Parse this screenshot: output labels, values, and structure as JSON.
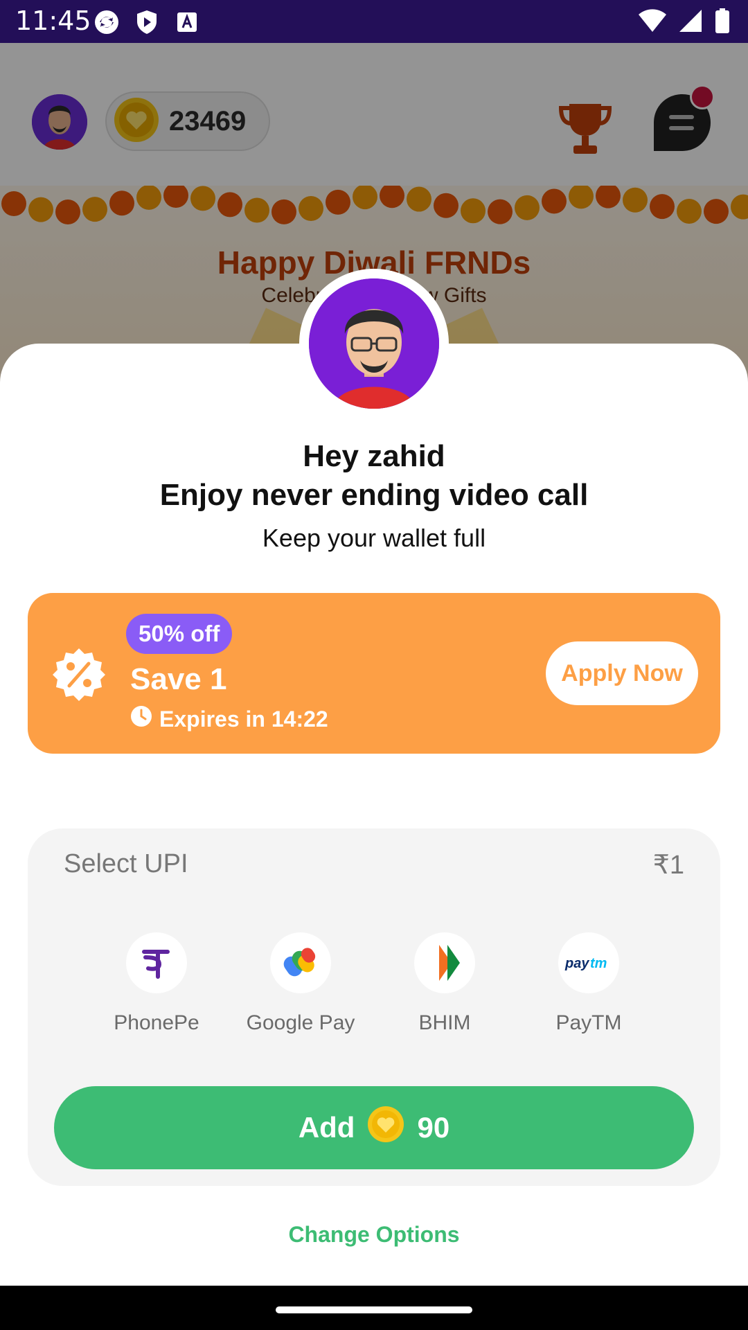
{
  "status_bar": {
    "time": "11:45"
  },
  "header": {
    "coin_balance": "23469"
  },
  "banner": {
    "title": "Happy Diwali FRNDs",
    "subtitle": "Celebrate with new Gifts"
  },
  "sheet": {
    "greeting": "Hey zahid",
    "headline": "Enjoy never ending video call",
    "tagline": "Keep your wallet full"
  },
  "offer": {
    "badge": "50% off",
    "title": "Save 1",
    "expiry": "Expires in 14:22",
    "apply_label": "Apply Now"
  },
  "upi": {
    "title": "Select UPI",
    "amount": "₹1",
    "options": [
      {
        "label": "PhonePe",
        "icon": "phonepe-icon"
      },
      {
        "label": "Google Pay",
        "icon": "google-pay-icon"
      },
      {
        "label": "BHIM",
        "icon": "bhim-icon"
      },
      {
        "label": "PayTM",
        "icon": "paytm-icon"
      }
    ],
    "add_label": "Add",
    "add_amount": "90"
  },
  "change_options_label": "Change Options",
  "colors": {
    "offer": "#fd9f45",
    "badge": "#8a5cf6",
    "add_button": "#3dbc74",
    "status_bar": "#230f58"
  }
}
